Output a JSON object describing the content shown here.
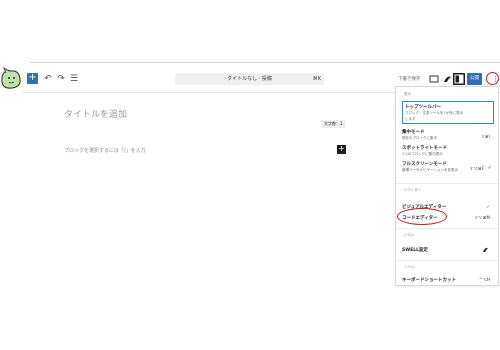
{
  "header": {
    "command_title": "タイトルなし · 投稿",
    "command_shortcut": "⌘K",
    "save_draft": "下書き保存",
    "publish": "公開",
    "options_icon": "more-vertical-icon"
  },
  "editor": {
    "title_placeholder": "タイトルを追加",
    "word_count": "文字数：1",
    "block_hint": "ブロックを選択するには「/」を入力"
  },
  "menu": {
    "sections": {
      "view": "表示",
      "editor": "エディター",
      "panel": "パネル",
      "tools": "ツール"
    },
    "view_items": [
      {
        "title": "トップツールバー",
        "desc1": "ブロック・文書ツールを1か所に表示",
        "desc2": "します",
        "shortcut": ""
      },
      {
        "title": "集中モード",
        "desc1": "現在のブロックに集中",
        "desc2": "",
        "shortcut": "⇧⌘\\"
      },
      {
        "title": "スポットライトモード",
        "desc1": "1つのブロックに集中表示",
        "desc2": "",
        "shortcut": ""
      },
      {
        "title": "フルスクリーンモード",
        "desc1": "管理バーやナビゲーションを非表示",
        "desc2": "",
        "shortcut": "⇧⌥⌘F"
      }
    ],
    "editor_items": [
      {
        "title": "ビジュアルエディター",
        "shortcut": "✓"
      },
      {
        "title": "コードエディター",
        "shortcut": "⇧⌥⌘M"
      }
    ],
    "panel_items": [
      {
        "title": "SWELL設定"
      }
    ],
    "tools_items": [
      {
        "title": "キーボードショートカット",
        "shortcut": "^⌥H"
      }
    ]
  },
  "colors": {
    "accent": "#2f6fb6",
    "highlight": "#c21f2f",
    "selected_border": "#3a88d6"
  }
}
